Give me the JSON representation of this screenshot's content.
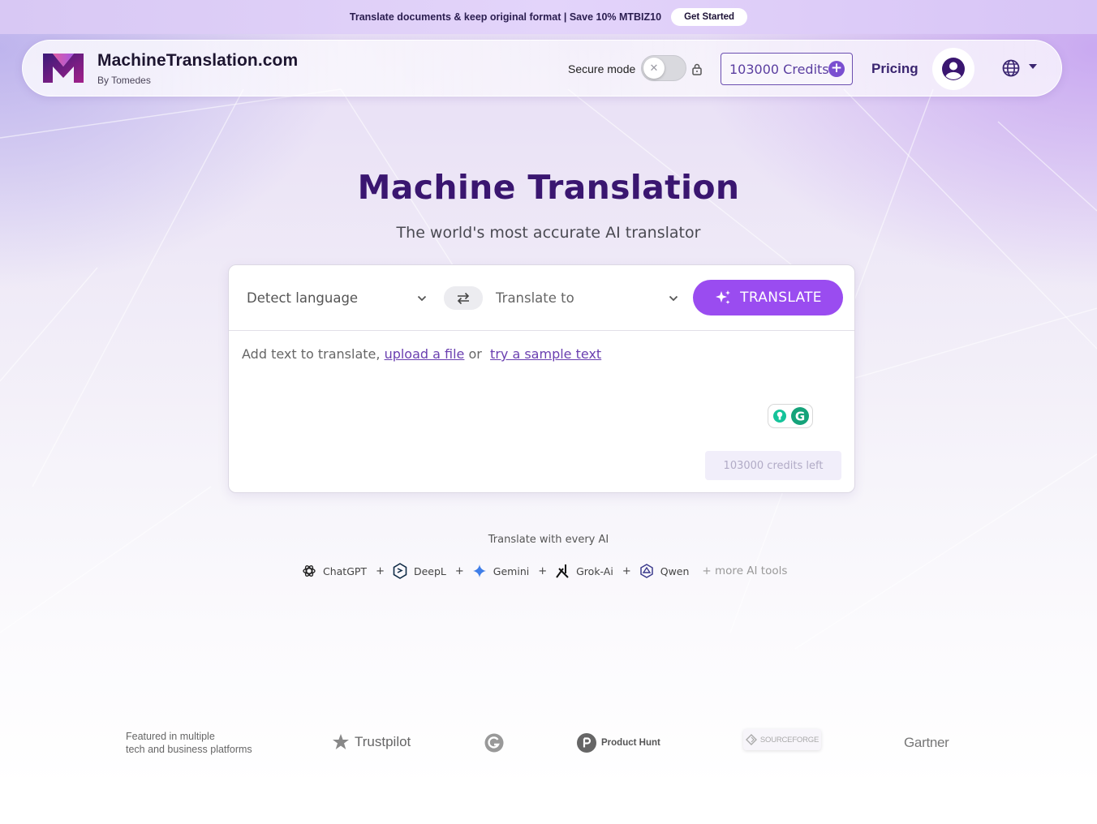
{
  "promo": {
    "text": "Translate documents & keep original format | Save 10% MTBIZ10",
    "button": "Get Started"
  },
  "header": {
    "brand_name": "MachineTranslation.com",
    "brand_sub": "By Tomedes",
    "secure_mode_label": "Secure mode",
    "secure_mode_on": false,
    "credits": "103000 Credits",
    "pricing": "Pricing"
  },
  "hero": {
    "title": "Machine Translation",
    "subtitle": "The world's most accurate AI translator"
  },
  "translator": {
    "source_language": "Detect language",
    "target_language": "Translate to",
    "translate_button": "TRANSLATE",
    "input_prefix": "Add text to translate,",
    "upload_link": "upload a file",
    "or_text": "or",
    "sample_link": "try a sample text",
    "credits_left": "103000 credits left"
  },
  "ai_tools": {
    "title": "Translate with every AI",
    "items": [
      "ChatGPT",
      "DeepL",
      "Gemini",
      "Grok-Ai",
      "Qwen"
    ],
    "plus": "+",
    "more": "+ more AI tools"
  },
  "featured": {
    "line1": "Featured in multiple",
    "line2": "tech and business platforms",
    "logos": [
      "Trustpilot",
      "G2",
      "Product Hunt",
      "SOURCEFORGE",
      "Gartner"
    ]
  },
  "colors": {
    "accent": "#9a4cf0",
    "brand_dark": "#3a1670",
    "link": "#6a3fb0"
  }
}
